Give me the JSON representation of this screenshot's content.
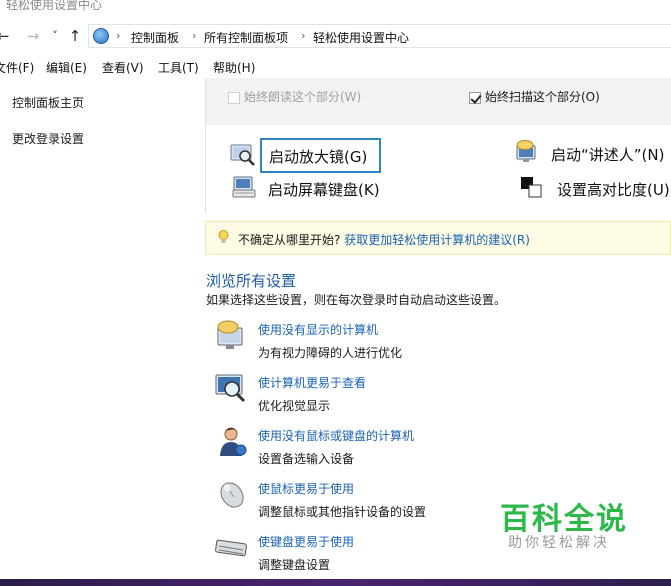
{
  "window": {
    "title": "轻松使用设置中心"
  },
  "nav": {
    "back": "←",
    "forward": "→",
    "recent": "˅",
    "up": "↑"
  },
  "breadcrumb": {
    "sep": "›",
    "items": [
      "控制面板",
      "所有控制面板项",
      "轻松使用设置中心"
    ]
  },
  "menu": [
    "文件(F)",
    "编辑(E)",
    "查看(V)",
    "工具(T)",
    "帮助(H)"
  ],
  "sidebar": {
    "items": [
      "控制面板主页",
      "更改登录设置"
    ]
  },
  "checkboxes": [
    {
      "label": "始终朗读这个部分(W)",
      "checked": false,
      "enabled": false
    },
    {
      "label": "始终扫描这个部分(O)",
      "checked": true,
      "enabled": true
    }
  ],
  "tools": {
    "magnifier": "启动放大镜(G)",
    "narrator": "启动“讲述人”(N)",
    "osk": "启动屏幕键盘(K)",
    "contrast": "设置高对比度(U)"
  },
  "tip": {
    "text": "不确定从哪里开始?",
    "link": "获取更加轻松使用计算机的建议(R)"
  },
  "section": {
    "title": "浏览所有设置",
    "subtitle": "如果选择这些设置，则在每次登录时自动启动这些设置。"
  },
  "settings": [
    {
      "link": "使用没有显示的计算机",
      "desc": "为有视力障碍的人进行优化",
      "icon": "monitor-speech-icon"
    },
    {
      "link": "使计算机更易于查看",
      "desc": "优化视觉显示",
      "icon": "magnify-monitor-icon"
    },
    {
      "link": "使用没有鼠标或键盘的计算机",
      "desc": "设置备选输入设备",
      "icon": "person-icon"
    },
    {
      "link": "使鼠标更易于使用",
      "desc": "调整鼠标或其他指针设备的设置",
      "icon": "mouse-icon"
    },
    {
      "link": "使键盘更易于使用",
      "desc": "调整键盘设置",
      "icon": "keyboard-icon"
    }
  ],
  "watermark": {
    "big": "百科全说",
    "small": "助你轻松解决"
  },
  "colors": {
    "link": "#1a63b4",
    "title": "#1f5aa3",
    "focus": "#2f86c7",
    "watermark": "#2db84a"
  }
}
